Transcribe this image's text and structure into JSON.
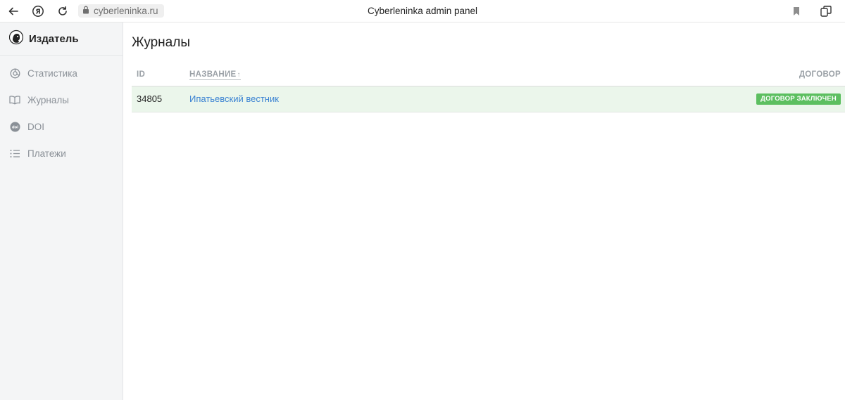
{
  "browser": {
    "url": "cyberleninka.ru",
    "page_title": "Cyberleninka admin panel"
  },
  "sidebar": {
    "brand": "Издатель",
    "items": [
      {
        "label": "Статистика",
        "icon": "chart-circle-icon"
      },
      {
        "label": "Журналы",
        "icon": "book-icon"
      },
      {
        "label": "DOI",
        "icon": "doi-icon"
      },
      {
        "label": "Платежи",
        "icon": "list-icon"
      }
    ]
  },
  "main": {
    "title": "Журналы",
    "columns": {
      "id": "ID",
      "name": "НАЗВАНИЕ",
      "sort_arrow": "↑",
      "contract": "ДОГОВОР"
    },
    "rows": [
      {
        "id": "34805",
        "name": "Ипатьевский вестник",
        "status": "ДОГОВОР ЗАКЛЮЧЕН"
      }
    ]
  },
  "colors": {
    "accent_link": "#3a82d2",
    "status_green": "#5cbf60",
    "row_highlight": "#ebf6eb",
    "sidebar_bg": "#f4f5f6"
  }
}
